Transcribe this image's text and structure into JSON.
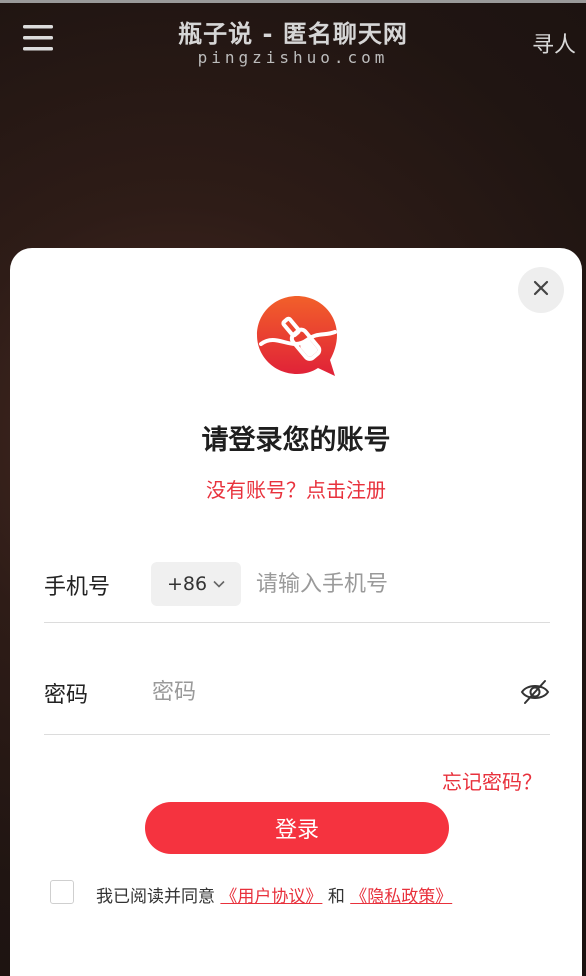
{
  "header": {
    "title": "瓶子说 - 匿名聊天网",
    "domain": "pingzishuo.com",
    "find_link": "寻人"
  },
  "login": {
    "title": "请登录您的账号",
    "register_link": "没有账号？点击注册",
    "phone_label": "手机号",
    "country_code": "+86",
    "phone_placeholder": "请输入手机号",
    "password_label": "密码",
    "password_placeholder": "密码",
    "forgot_link": "忘记密码？",
    "submit_label": "登录"
  },
  "agreement": {
    "prefix": "我已阅读并同意",
    "user_agreement": "《用户协议》",
    "and": "和",
    "privacy_policy": "《隐私政策》"
  },
  "colors": {
    "accent": "#f5333f",
    "link": "#e8313c",
    "logo_top": "#f05a2c",
    "logo_bottom": "#e0233a"
  },
  "icons": {
    "menu": "hamburger-icon",
    "close": "close-icon",
    "logo": "bottle-logo-icon",
    "dropdown": "chevron-down-icon",
    "visibility": "eye-off-icon"
  }
}
